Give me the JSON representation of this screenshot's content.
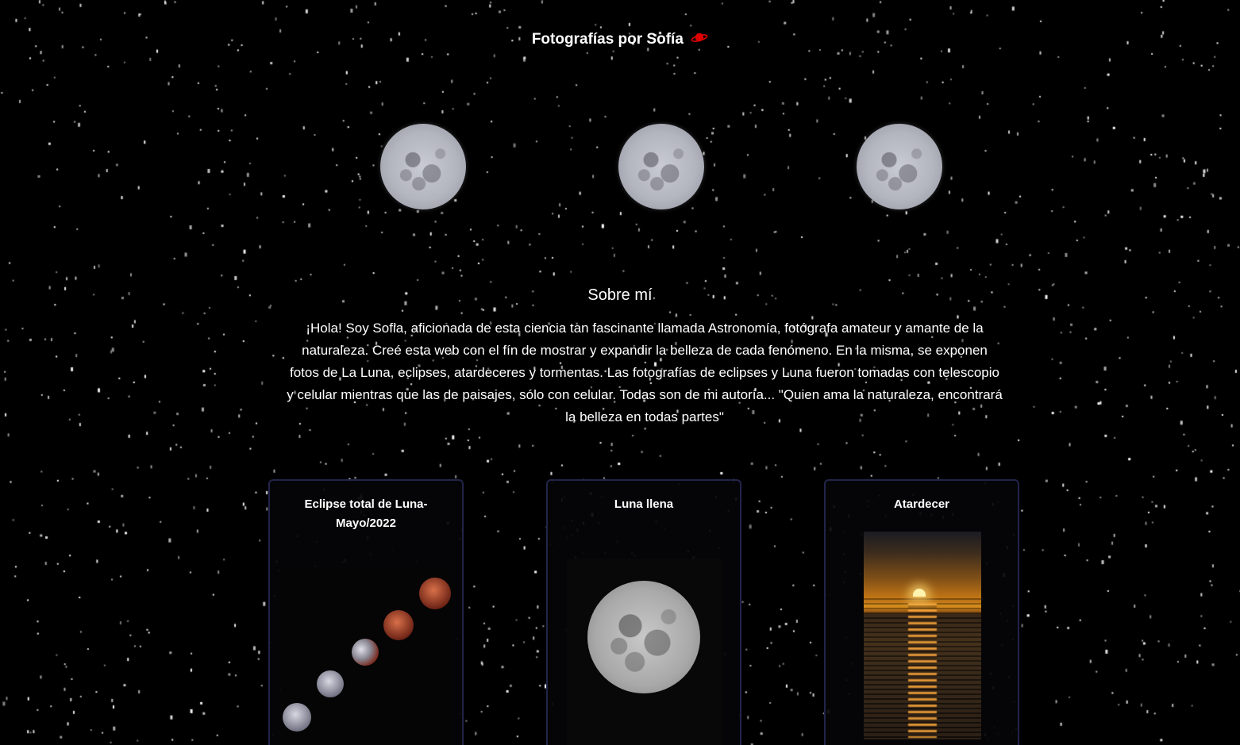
{
  "header": {
    "title": "Fotografías por Sofía",
    "title_icon": "planet-icon",
    "title_icon_color": "#e00000"
  },
  "hero": {
    "images": [
      "moon-image",
      "moon-image",
      "moon-image"
    ]
  },
  "about": {
    "heading": "Sobre mí",
    "text": "¡Hola! Soy Sofia, aficionada de esta ciencia tan fascinante llamada Astronomía, fotógrafa amateur y amante de la naturaleza. Creé esta web con el fín de mostrar y expandir la belleza de cada fenómeno. En la misma, se exponen fotos de La Luna, eclipses, atardeceres y tormentas. Las fotografías de eclipses y Luna fueron tomadas con telescopio y celular mientras que las de paisajes, sólo con celular. Todas son de mi autoría... \"Quien ama la naturaleza, encontrará la belleza en todas partes\""
  },
  "gallery": {
    "cards": [
      {
        "title": "Eclipse total de Luna- Mayo/2022",
        "image": "lunar-eclipse-sequence"
      },
      {
        "title": "Luna llena",
        "image": "full-moon"
      },
      {
        "title": "Atardecer",
        "image": "sunset-over-sea"
      }
    ]
  },
  "colors": {
    "background": "#000000",
    "text": "#ffffff",
    "card_border": "#22244a"
  }
}
